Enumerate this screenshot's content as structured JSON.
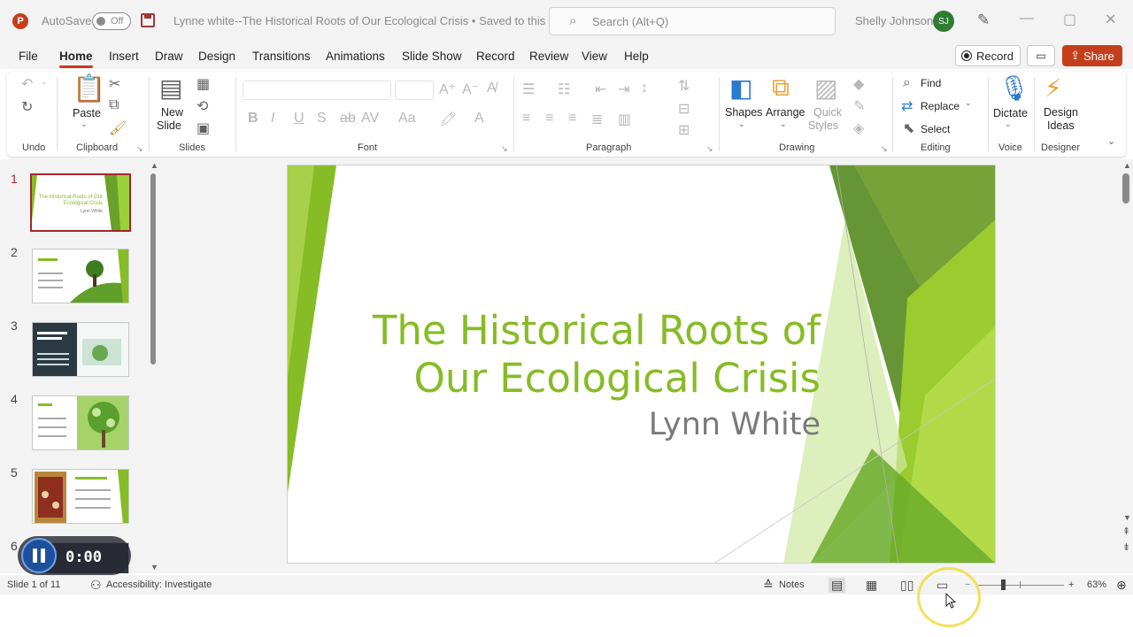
{
  "titlebar": {
    "autosave_label": "AutoSave",
    "autosave_state": "Off",
    "document_title": "Lynne white--The Historical Roots of Our Ecological Crisis • Saved to this PC",
    "search_placeholder": "Search (Alt+Q)",
    "user_name": "Shelly Johnson",
    "user_initials": "SJ"
  },
  "menu": {
    "tabs": [
      "File",
      "Home",
      "Insert",
      "Draw",
      "Design",
      "Transitions",
      "Animations",
      "Slide Show",
      "Record",
      "Review",
      "View",
      "Help"
    ],
    "active_tab": "Home",
    "record_label": "Record",
    "share_label": "Share"
  },
  "ribbon": {
    "undo_group": "Undo",
    "clipboard_group": "Clipboard",
    "paste_label": "Paste",
    "slides_group": "Slides",
    "new_slide_label_1": "New",
    "new_slide_label_2": "Slide",
    "font_group": "Font",
    "paragraph_group": "Paragraph",
    "drawing_group": "Drawing",
    "shapes_label": "Shapes",
    "arrange_label": "Arrange",
    "quick_styles_1": "Quick",
    "quick_styles_2": "Styles",
    "editing_group": "Editing",
    "find_label": "Find",
    "replace_label": "Replace",
    "select_label": "Select",
    "voice_group": "Voice",
    "dictate_label": "Dictate",
    "designer_group": "Designer",
    "design_ideas_1": "Design",
    "design_ideas_2": "Ideas"
  },
  "thumbnails": {
    "numbers": [
      "1",
      "2",
      "3",
      "4",
      "5",
      "6"
    ],
    "slide1_title": "The Historical Roots of Our Ecological Crisis",
    "slide1_sub": "Lynn White"
  },
  "slide": {
    "title_line1": "The Historical Roots of",
    "title_line2": "Our Ecological Crisis",
    "subtitle": "Lynn White",
    "accent_color": "#86bc25"
  },
  "recording": {
    "timer": "0:00"
  },
  "statusbar": {
    "slide_indicator": "Slide 1 of 11",
    "accessibility": "Accessibility: Investigate",
    "notes_label": "Notes",
    "zoom_level": "63%"
  }
}
